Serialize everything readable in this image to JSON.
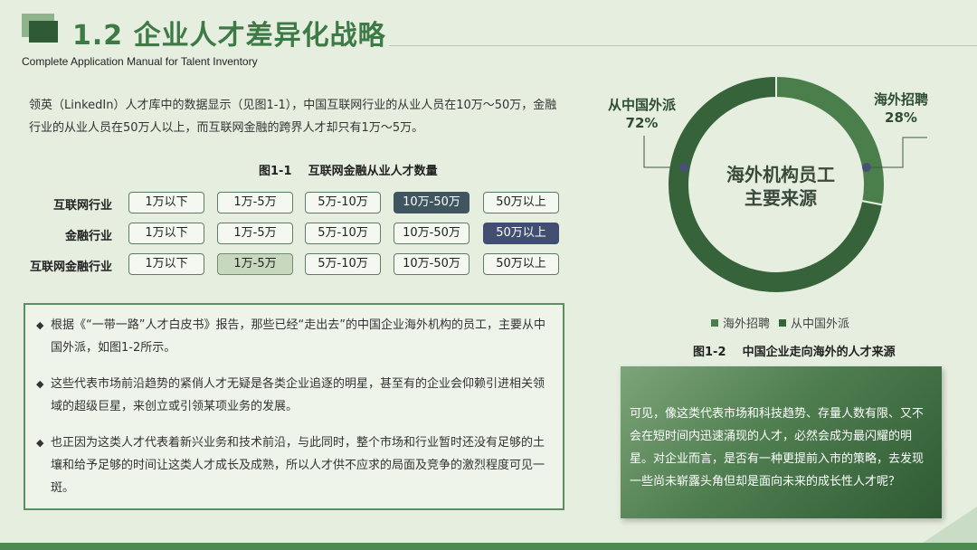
{
  "header": {
    "title": "1.2 企业人才差异化战略",
    "subtitle": "Complete Application Manual for Talent Inventory"
  },
  "intro": {
    "text": "领英（LinkedIn）人才库中的数据显示（见图1-1），中国互联网行业的从业人员在10万～50万，金融行业的从业人员在50万人以上，而互联网金融的跨界人才却只有1万～5万。"
  },
  "figure1": {
    "caption": "图1-1    互联网金融从业人才数量",
    "options": [
      "1万以下",
      "1万-5万",
      "5万-10万",
      "10万-50万",
      "50万以上"
    ],
    "rows": [
      {
        "label": "互联网行业",
        "selected": 3
      },
      {
        "label": "金融行业",
        "selected": 4
      },
      {
        "label": "互联网金融行业",
        "selected": 1
      }
    ]
  },
  "bullets": [
    "根据《“一带一路”人才白皮书》报告，那些已经“走出去”的中国企业海外机构的员工，主要从中国外派，如图1-2所示。",
    "这些代表市场前沿趋势的紧俏人才无疑是各类企业追逐的明星，甚至有的企业会仰赖引进相关领域的超级巨星，来创立或引领某项业务的发展。",
    "也正因为这类人才代表着新兴业务和技术前沿，与此同时，整个市场和行业暂时还没有足够的土壤和给予足够的时间让这类人才成长及成熟，所以人才供不应求的局面及竞争的激烈程度可见一斑。"
  ],
  "bullet_mark": "◆",
  "chart_data": {
    "type": "pie",
    "title": "图1-2    中国企业走向海外的人才来源",
    "center_label_line1": "海外机构员工",
    "center_label_line2": "主要来源",
    "series": [
      {
        "name": "海外招聘",
        "value": 28,
        "label": "28%",
        "color": "#4a7f4c"
      },
      {
        "name": "从中国外派",
        "value": 72,
        "label": "72%",
        "color": "#37633a"
      }
    ],
    "legend_position": "bottom"
  },
  "note": {
    "text": "可见，像这类代表市场和科技趋势、存量人数有限、又不会在短时间内迅速涌现的人才，必然会成为最闪耀的明星。对企业而言，是否有一种更提前入市的策略，去发现一些尚未崭露头角但却是面向未来的成长性人才呢？"
  },
  "colors": {
    "accent": "#3d7a46",
    "background": "#e6eee0"
  }
}
